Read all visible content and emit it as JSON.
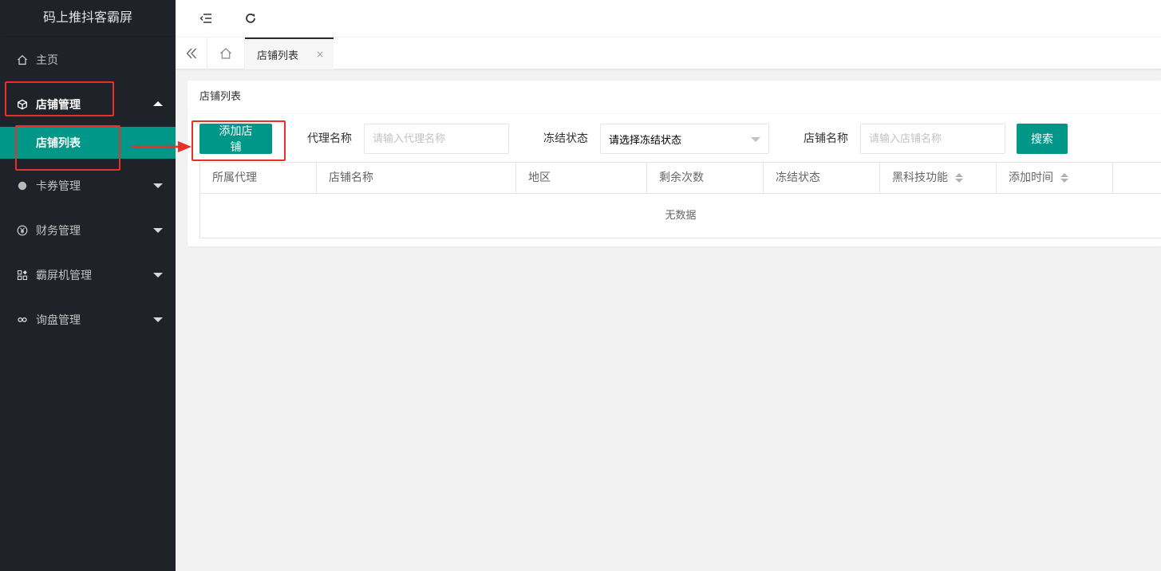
{
  "app": {
    "title": "码上推抖客霸屏"
  },
  "sidebar": {
    "items": [
      {
        "label": "主页",
        "icon": "home-icon"
      },
      {
        "label": "店铺管理",
        "icon": "cube-icon",
        "open": true,
        "children": [
          {
            "label": "店铺列表"
          }
        ]
      },
      {
        "label": "卡券管理",
        "icon": "circle-icon"
      },
      {
        "label": "财务管理",
        "icon": "yen-icon"
      },
      {
        "label": "霸屏机管理",
        "icon": "apps-icon"
      },
      {
        "label": "询盘管理",
        "icon": "link-icon"
      }
    ]
  },
  "header": {
    "icons": [
      "menu-collapse-icon",
      "refresh-icon"
    ]
  },
  "tabs": {
    "active": {
      "label": "店铺列表",
      "close": "×"
    },
    "icons": [
      "double-chevron-left-icon",
      "home-icon"
    ]
  },
  "card": {
    "title": "店铺列表",
    "add_button": "添加店铺",
    "filters": {
      "agent_label": "代理名称",
      "agent_placeholder": "请输入代理名称",
      "freeze_label": "冻结状态",
      "freeze_value": "请选择冻结状态",
      "shop_label": "店铺名称",
      "shop_placeholder": "请输入店铺名称",
      "search_button": "搜索"
    },
    "table": {
      "columns": [
        "所属代理",
        "店铺名称",
        "地区",
        "剩余次数",
        "冻结状态",
        "黑科技功能",
        "添加时间"
      ],
      "empty_text": "无数据"
    }
  },
  "colors": {
    "accent": "#009688",
    "sidebar_bg": "#20222a",
    "annotation": "#e8302a"
  }
}
